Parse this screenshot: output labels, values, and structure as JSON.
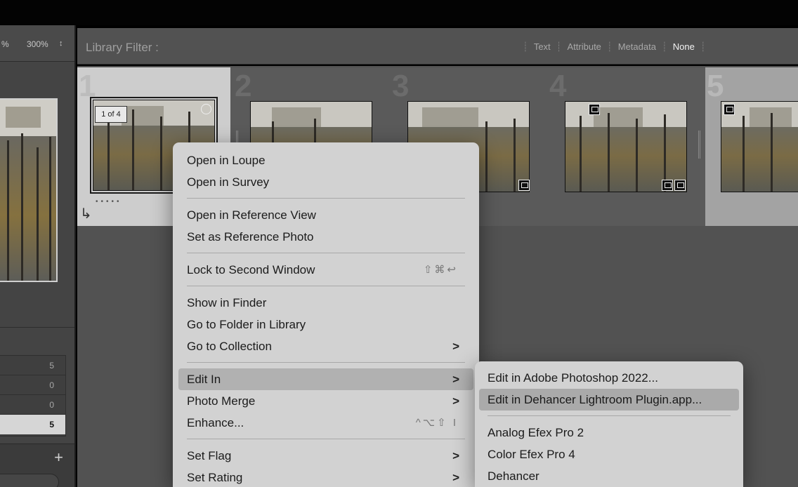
{
  "left_panel": {
    "zoom_partial": "%",
    "zoom_value": "300%",
    "zoom_stepper": "↕",
    "counts": [
      "5",
      "0",
      "0",
      "5"
    ],
    "plus_label": "+"
  },
  "filter": {
    "title": "Library Filter :",
    "tabs": [
      "Text",
      "Attribute",
      "Metadata",
      "None"
    ],
    "active_tab": "None"
  },
  "grid": {
    "cells": [
      {
        "number": "1",
        "stack_badge": "1 of 4",
        "selected": true
      },
      {
        "number": "2"
      },
      {
        "number": "3"
      },
      {
        "number": "4"
      },
      {
        "number": "5"
      }
    ],
    "dots": "•••••",
    "icons": [
      "stack-arrow-icon",
      "sync-icon",
      "comment-icon",
      "edit-icon"
    ]
  },
  "context_menu": {
    "items": [
      {
        "label": "Open in Loupe"
      },
      {
        "label": "Open in Survey"
      },
      {
        "separator": true
      },
      {
        "label": "Open in Reference View"
      },
      {
        "label": "Set as Reference Photo"
      },
      {
        "separator": true
      },
      {
        "label": "Lock to Second Window",
        "shortcut": "⇧⌘↩"
      },
      {
        "separator": true
      },
      {
        "label": "Show in Finder"
      },
      {
        "label": "Go to Folder in Library"
      },
      {
        "label": "Go to Collection",
        "submenu": true
      },
      {
        "separator": true
      },
      {
        "label": "Edit In",
        "submenu": true,
        "highlighted": true
      },
      {
        "label": "Photo Merge",
        "submenu": true
      },
      {
        "label": "Enhance...",
        "shortcut": "^⌥⇧ I"
      },
      {
        "separator": true
      },
      {
        "label": "Set Flag",
        "submenu": true
      },
      {
        "label": "Set Rating",
        "submenu": true
      }
    ]
  },
  "submenu": {
    "items": [
      {
        "label": "Edit in Adobe Photoshop 2022..."
      },
      {
        "label": "Edit in Dehancer Lightroom Plugin.app...",
        "highlighted": true
      },
      {
        "separator": true
      },
      {
        "label": "Analog Efex Pro 2"
      },
      {
        "label": "Color Efex Pro 4"
      },
      {
        "label": "Dehancer"
      }
    ]
  },
  "chevron": ">"
}
